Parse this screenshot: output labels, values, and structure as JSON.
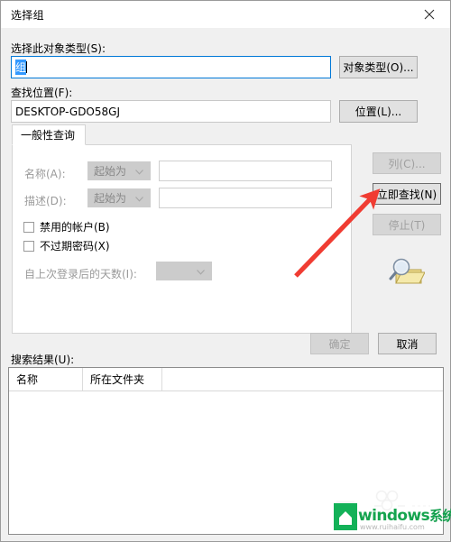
{
  "window": {
    "title": "选择组",
    "close_icon": "close-icon"
  },
  "object_type": {
    "label": "选择此对象类型(S):",
    "value": "组",
    "button": "对象类型(O)..."
  },
  "location": {
    "label": "查找位置(F):",
    "value": "DESKTOP-GDO58GJ",
    "button": "位置(L)..."
  },
  "query_tab": {
    "tab_label": "一般性查询",
    "fields": [
      {
        "label": "名称(A):",
        "condition": "起始为",
        "value": ""
      },
      {
        "label": "描述(D):",
        "condition": "起始为",
        "value": ""
      }
    ],
    "checkboxes": [
      {
        "label": "禁用的帐户(B)",
        "checked": false
      },
      {
        "label": "不过期密码(X)",
        "checked": false
      }
    ],
    "days_label": "自上次登录后的天数(I):",
    "days_value": ""
  },
  "side_buttons": [
    {
      "label": "列(C)...",
      "state": "disabled"
    },
    {
      "label": "立即查找(N)",
      "state": "default"
    },
    {
      "label": "停止(T)",
      "state": "disabled"
    }
  ],
  "side_icon": "search-folder-icon",
  "dialog_buttons": [
    {
      "label": "确定",
      "state": "disabled"
    },
    {
      "label": "取消",
      "state": "normal"
    }
  ],
  "results": {
    "label": "搜索结果(U):",
    "columns": [
      "名称",
      "所在文件夹"
    ],
    "rows": []
  },
  "annotation": {
    "type": "arrow",
    "color": "#f03c32",
    "points_to": "立即查找(N)"
  },
  "watermark": {
    "brand_en": "windows",
    "brand_cn": "系统家园",
    "url": "www.ruihaifu.com",
    "green": "#13b158"
  }
}
